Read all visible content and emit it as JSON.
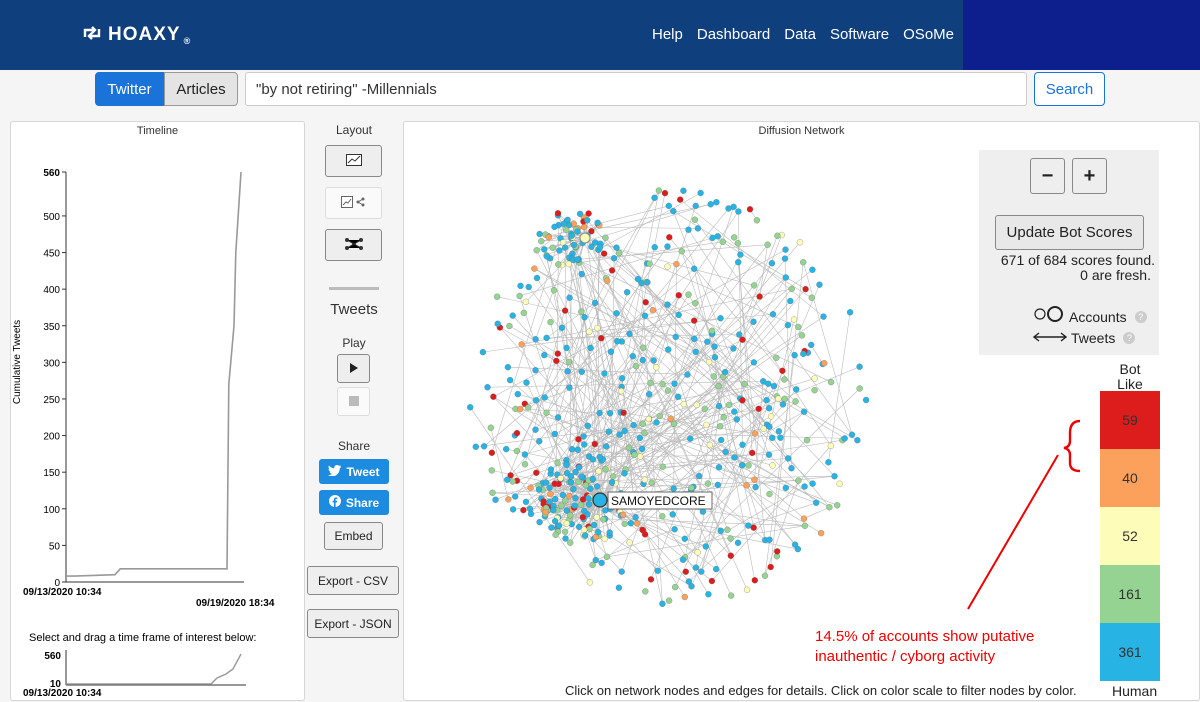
{
  "header": {
    "logo": "HOAXY",
    "logo_mark": "®",
    "nav": [
      "Help",
      "Dashboard",
      "Data",
      "Software",
      "OSoMe"
    ]
  },
  "search": {
    "tabs": [
      "Twitter",
      "Articles"
    ],
    "query": "\"by not retiring\" -Millennials",
    "button": "Search"
  },
  "timeline": {
    "title": "Timeline",
    "ylabel": "Cumulative Tweets",
    "start_label": "09/13/2020 10:34",
    "end_label": "09/19/2020 18:34",
    "select_label": "Select and drag a time frame of interest below:",
    "mini_ticks": [
      "560",
      "10"
    ],
    "mini_start": "09/13/2020 10:34"
  },
  "chart_data": {
    "type": "line",
    "ylim": [
      0,
      560
    ],
    "yticks": [
      0,
      50,
      100,
      150,
      200,
      250,
      300,
      350,
      400,
      450,
      500,
      560
    ],
    "series": [
      {
        "x_frac": [
          0,
          0.05,
          0.28,
          0.31,
          0.92,
          0.93,
          0.96,
          0.97,
          1.0
        ],
        "values": [
          8,
          8,
          10,
          18,
          18,
          270,
          350,
          450,
          560
        ]
      }
    ]
  },
  "layout_panel": {
    "title": "Layout",
    "tweets_label": "Tweets",
    "play_label": "Play",
    "share_label": "Share",
    "tweet_btn": "Tweet",
    "share_btn": "Share",
    "embed_btn": "Embed",
    "export_csv": "Export - CSV",
    "export_json": "Export - JSON"
  },
  "network": {
    "title": "Diffusion Network",
    "highlighted_node": "SAMOYEDCORE",
    "footer": "Click on network nodes and edges for details. Click on color scale to filter nodes by color."
  },
  "bot_panel": {
    "zoom_out": "−",
    "zoom_in": "+",
    "update_btn": "Update Bot Scores",
    "scores_found": "671 of 684 scores found.",
    "fresh": "0 are fresh.",
    "legend_accounts": "Accounts",
    "legend_tweets": "Tweets",
    "scale_top_1": "Bot",
    "scale_top_2": "Like",
    "scale_bottom": "Human"
  },
  "bot_scale": [
    {
      "count": "59",
      "color": "#dd1c1c"
    },
    {
      "count": "40",
      "color": "#fba15b"
    },
    {
      "count": "52",
      "color": "#fdfdb9"
    },
    {
      "count": "161",
      "color": "#95d392"
    },
    {
      "count": "361",
      "color": "#27b3e3"
    }
  ],
  "annotation": {
    "line1": "14.5% of accounts show putative",
    "line2": "inauthentic / cyborg activity"
  },
  "colors": {
    "header_bg": "#0f3f7d",
    "accent": "#1a73d9",
    "annotation": "#e00000"
  }
}
